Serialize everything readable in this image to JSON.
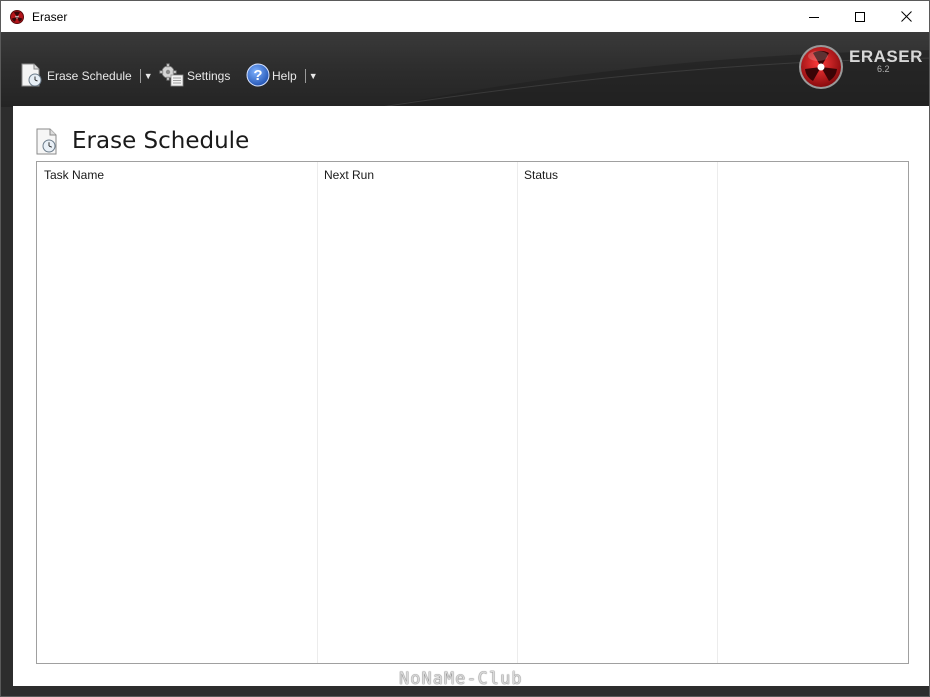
{
  "window": {
    "title": "Eraser"
  },
  "toolbar": {
    "erase_schedule_label": "Erase Schedule",
    "settings_label": "Settings",
    "help_label": "Help"
  },
  "brand": {
    "name": "ERASER",
    "version": "6.2"
  },
  "page": {
    "title": "Erase Schedule"
  },
  "task_list": {
    "columns": [
      "Task Name",
      "Next Run",
      "Status"
    ],
    "rows": []
  },
  "watermark": "NoNaMe-Club",
  "colors": {
    "toolbar_bg": "#2e2e2e",
    "logo_red": "#c8191e",
    "help_blue": "#2f6fd6"
  },
  "icons": {
    "app": "eraser-app-icon",
    "erase_schedule": "schedule-document-icon",
    "settings": "gear-icon",
    "help": "help-icon"
  }
}
